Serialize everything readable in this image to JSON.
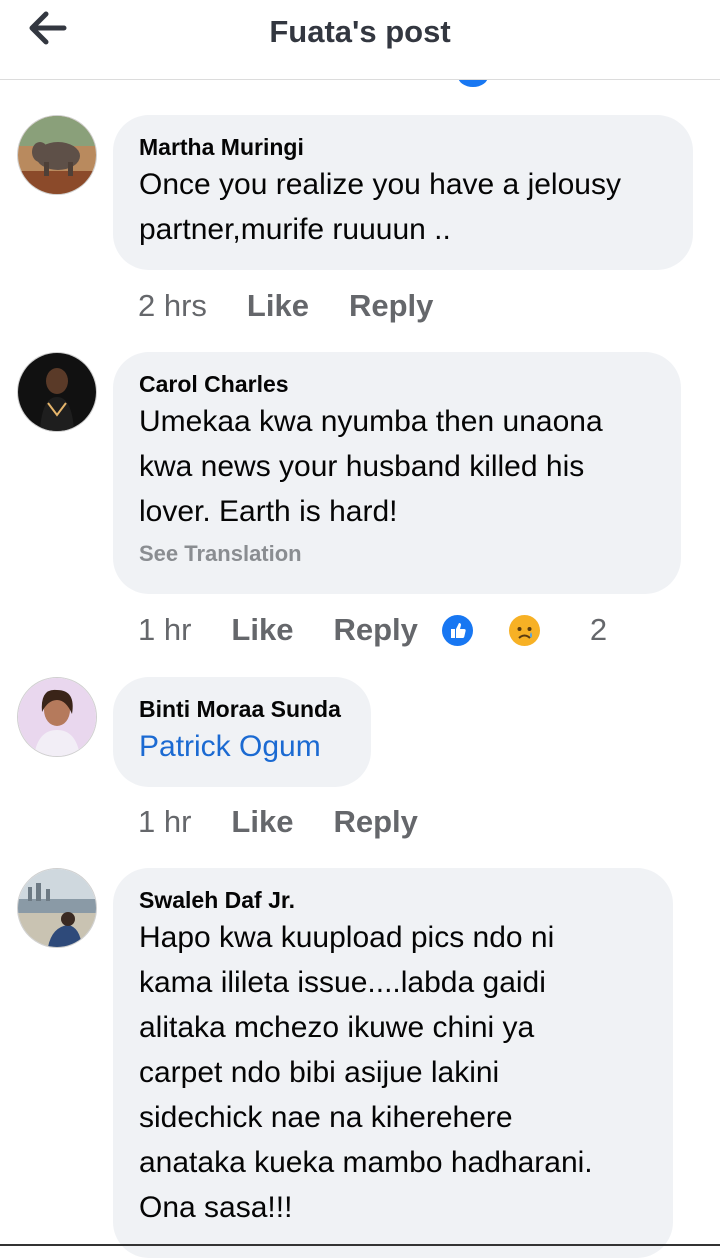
{
  "header": {
    "title": "Fuata's post",
    "back_icon": "arrow-left-icon"
  },
  "comments": [
    {
      "author": "Martha Muringi",
      "text": "Once you realize you have a jelousy\npartner,murife ruuuun ..",
      "time": "2 hrs",
      "like": "Like",
      "reply": "Reply"
    },
    {
      "author": "Carol Charles",
      "text": "Umekaa kwa nyumba then unaona\nkwa news your husband killed his\nlover. Earth is hard!",
      "see_translation": "See Translation",
      "time": "1 hr",
      "like": "Like",
      "reply": "Reply",
      "reactions": {
        "icons": [
          "like-reaction-icon",
          "sad-reaction-icon"
        ],
        "count": "2"
      }
    },
    {
      "author": "Binti Moraa Sunda",
      "mention": "Patrick Ogum",
      "time": "1 hr",
      "like": "Like",
      "reply": "Reply"
    },
    {
      "author": "Swaleh Daf Jr.",
      "text": "Hapo kwa kuupload pics ndo ni\nkama ilileta issue....labda gaidi\nalitaka mchezo ikuwe chini ya\ncarpet ndo bibi asijue lakini\nsidechick nae na kiherehere\nanataka kueka mambo hadharani.\nOna sasa!!!"
    }
  ],
  "colors": {
    "bubble": "#f0f2f5",
    "link": "#1b6ad2",
    "meta": "#65676b",
    "like_blue": "#1877f2"
  }
}
